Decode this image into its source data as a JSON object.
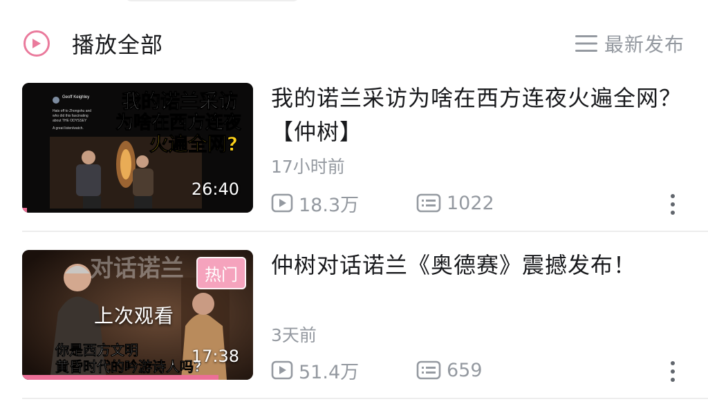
{
  "header": {
    "play_all_label": "播放全部",
    "sort_label": "最新发布",
    "play_icon": "play-circle-icon",
    "sort_icon": "sort-lines-icon"
  },
  "colors": {
    "accent_pink": "#ea7a9c",
    "text_primary": "#18191c",
    "text_secondary": "#9499a0",
    "hot_tag_bg": "#f5a3bd"
  },
  "videos": [
    {
      "title": "我的诺兰采访为啥在西方连夜火遍全网？ 【仲树】",
      "time": "17小时前",
      "views": "18.3万",
      "danmaku": "1022",
      "duration": "26:40",
      "watch_progress": 0.02,
      "thumbnail": {
        "headline_line1": "我的诺兰采访",
        "headline_line2": "为啥在西方连夜",
        "headline_line3": "火遍全网?",
        "tweet_name": "Geoff Keighley",
        "tweet_text_1": "Hats off to Zhongshu and",
        "tweet_text_2": "who did this fascinating",
        "tweet_text_3": "about THE ODYSSEY",
        "tweet_text_4": "A great listen/watch."
      }
    },
    {
      "title": "仲树对话诺兰《奥德赛》震撼发布！",
      "time": "3天前",
      "views": "51.4万",
      "danmaku": "659",
      "duration": "17:38",
      "watch_progress": 0.85,
      "thumbnail": {
        "hot_tag": "热门",
        "last_watched": "上次观看",
        "overlay_top": "对话诺兰",
        "overlay_line1": "你是西方文明",
        "overlay_line2": "黄昏时代的吟游诗人吗?"
      }
    }
  ]
}
